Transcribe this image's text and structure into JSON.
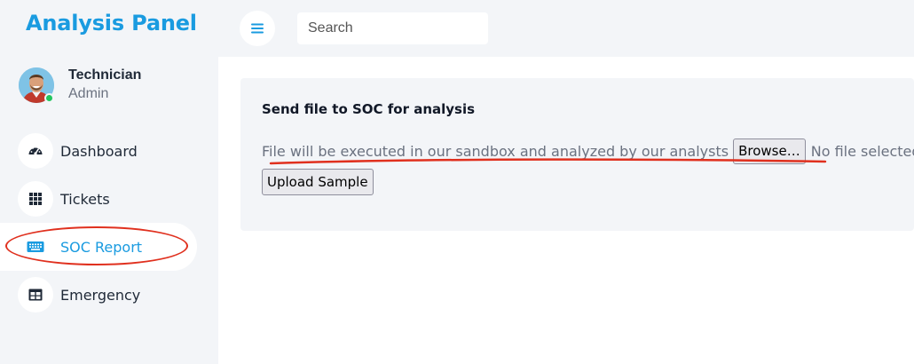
{
  "app": {
    "title": "Analysis Panel"
  },
  "profile": {
    "name": "Technician",
    "role": "Admin",
    "status": "online"
  },
  "sidebar": {
    "items": [
      {
        "label": "Dashboard",
        "icon": "gauge-icon",
        "active": false
      },
      {
        "label": "Tickets",
        "icon": "grid-icon",
        "active": false
      },
      {
        "label": "SOC Report",
        "icon": "keyboard-icon",
        "active": true
      },
      {
        "label": "Emergency",
        "icon": "table-icon",
        "active": false
      }
    ]
  },
  "header": {
    "menu_icon": "hamburger-icon",
    "search_placeholder": "Search"
  },
  "upload_card": {
    "title": "Send file to SOC for analysis",
    "hint": "File will be executed in our sandbox and analyzed by our analysts",
    "browse_label": "Browse…",
    "file_status": "No file selected.",
    "upload_label": "Upload Sample"
  },
  "colors": {
    "brand": "#1a9be0",
    "sidebar_bg": "#f3f5f8",
    "annotation": "#e0301e",
    "online": "#22c55e"
  }
}
